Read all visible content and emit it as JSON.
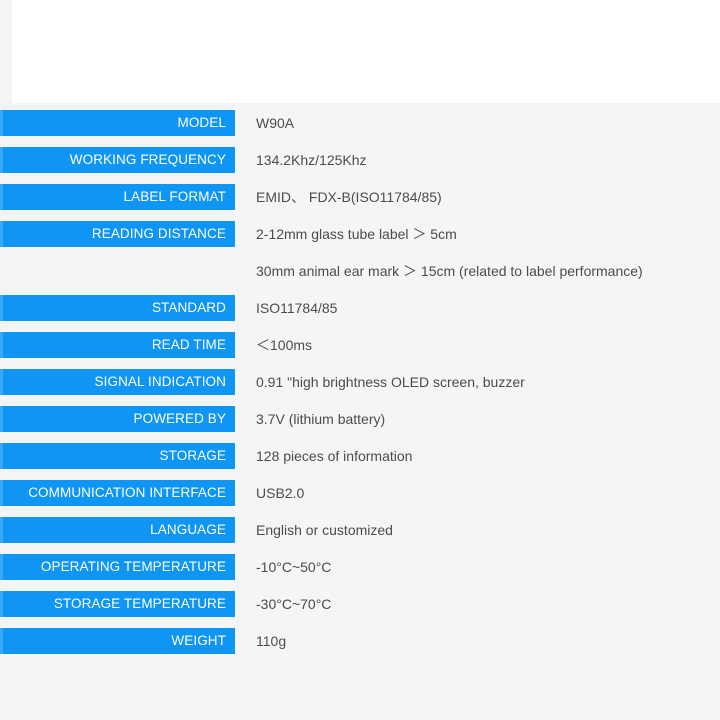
{
  "colors": {
    "label_bar": "#0f96f4",
    "label_text": "#ffffff",
    "value_text": "#4c4c4c",
    "page_background": "#f4f5f6",
    "banner_background": "#ffffff"
  },
  "spec_table": {
    "rows": [
      {
        "label": "MODEL",
        "value": "W90A"
      },
      {
        "label": "WORKING FREQUENCY",
        "value": "134.2Khz/125Khz"
      },
      {
        "label": "LABEL FORMAT",
        "value": "EMID、 FDX-B(ISO11784/85)"
      },
      {
        "label": "READING DISTANCE",
        "value": "2-12mm glass tube label ＞ 5cm"
      },
      {
        "label": "",
        "value": "30mm animal ear mark ＞ 15cm (related to label performance)"
      },
      {
        "label": "STANDARD",
        "value": "ISO11784/85"
      },
      {
        "label": "READ TIME",
        "value": "＜100ms"
      },
      {
        "label": "SIGNAL INDICATION",
        "value": "0.91 \"high brightness OLED screen, buzzer"
      },
      {
        "label": "POWERED BY",
        "value": "3.7V (lithium battery)"
      },
      {
        "label": "STORAGE",
        "value": "128 pieces of information"
      },
      {
        "label": "COMMUNICATION INTERFACE",
        "value": "USB2.0"
      },
      {
        "label": "LANGUAGE",
        "value": "English or customized"
      },
      {
        "label": "OPERATING TEMPERATURE",
        "value": "-10°C~50°C"
      },
      {
        "label": "STORAGE TEMPERATURE",
        "value": "-30°C~70°C"
      },
      {
        "label": "WEIGHT",
        "value": "110g"
      }
    ]
  }
}
